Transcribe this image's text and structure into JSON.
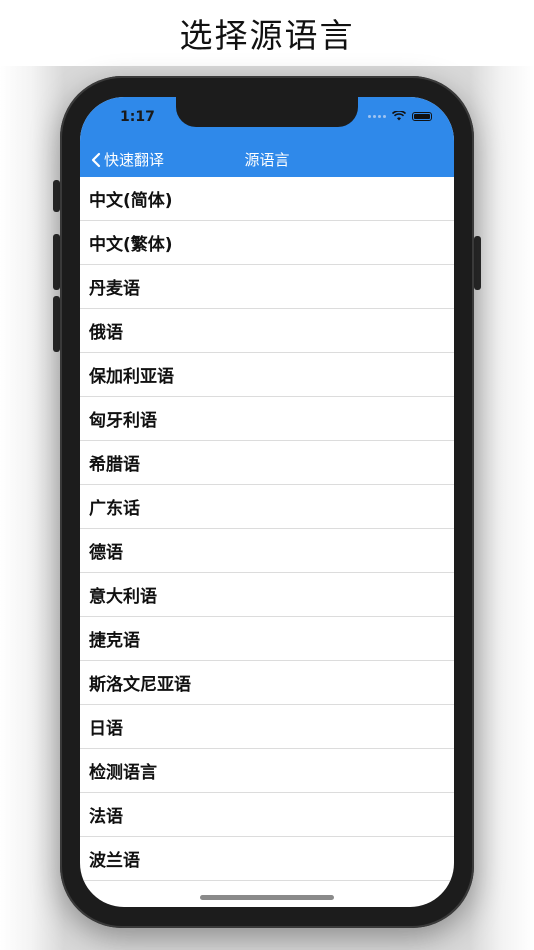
{
  "caption": "选择源语言",
  "status_bar": {
    "time": "1:17"
  },
  "nav": {
    "back_label": "快速翻译",
    "title": "源语言"
  },
  "languages": [
    "中文(简体)",
    "中文(繁体)",
    "丹麦语",
    "俄语",
    "保加利亚语",
    "匈牙利语",
    "希腊语",
    "广东话",
    "德语",
    "意大利语",
    "捷克语",
    "斯洛文尼亚语",
    "日语",
    "检测语言",
    "法语",
    "波兰语"
  ],
  "colors": {
    "accent": "#2f89ea",
    "frame": "#1c1c1c"
  }
}
